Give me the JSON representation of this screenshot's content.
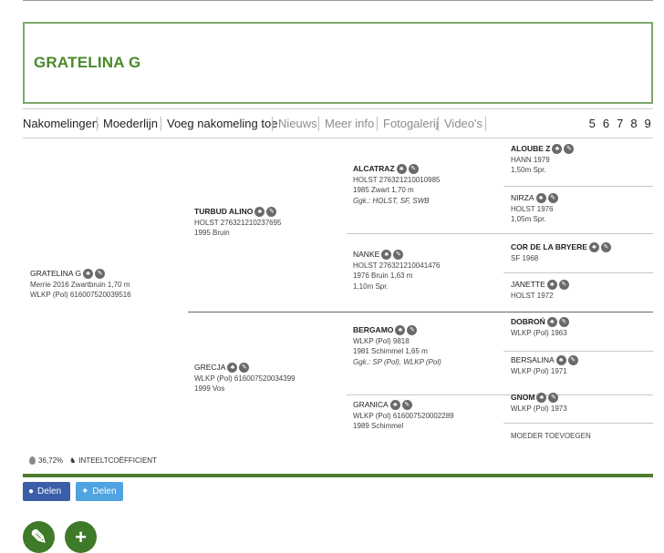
{
  "title": "GRATELINA G",
  "tabs": [
    {
      "label": "Nakomelingen"
    },
    {
      "label": "Moederlijn"
    },
    {
      "label": "Voeg nakomeling toe"
    },
    {
      "label": "Nieuws"
    },
    {
      "label": "Meer info"
    },
    {
      "label": "Fotogalerij"
    },
    {
      "label": "Video's"
    }
  ],
  "pages": "5 6 7 8 9",
  "subject": {
    "name": "GRATELINA G",
    "line1": "Merrie 2016 Zwartbruin 1,70 m",
    "line2": "WLKP (Pol) 616007520039516"
  },
  "sire": {
    "name": "TURBUD ALINO",
    "line1": "HOLST 276321210237695",
    "line2": "1995 Bruin"
  },
  "dam": {
    "name": "GRECJA",
    "line1": "WLKP (Pol) 616007520034399",
    "line2": "1999 Vos"
  },
  "ss": {
    "name": "ALCATRAZ",
    "line1": "HOLST 276321210010985",
    "line2": "1985 Zwart 1,70 m",
    "line3": "Ggk.: HOLST, SF, SWB"
  },
  "sd": {
    "name": "NANKE",
    "line1": "HOLST 276321210041476",
    "line2": "1976 Bruin 1,63 m",
    "line3": "1,10m Spr."
  },
  "ds": {
    "name": "BERGAMO",
    "line1": "WLKP (Pol) 9818",
    "line2": "1981 Schimmel 1,65 m",
    "line3": "Ggk.: SP (Pol), WLKP (Pol)"
  },
  "dd": {
    "name": "GRANICA",
    "line1": "WLKP (Pol) 616007520002289",
    "line2": "1989 Schimmel"
  },
  "g4": [
    {
      "name": "ALOUBE Z",
      "line1": "HANN 1979",
      "line2": "1,50m Spr."
    },
    {
      "name": "NIRZA",
      "line1": "HOLST 1976",
      "line2": "1,05m Spr."
    },
    {
      "name": "COR DE LA BRYERE",
      "line1": "SF 1968"
    },
    {
      "name": "JANETTE",
      "line1": "HOLST 1972"
    },
    {
      "name": "DOBROŃ",
      "line1": "WLKP (Pol) 1963"
    },
    {
      "name": "BERSALINA",
      "line1": "WLKP (Pol) 1971"
    },
    {
      "name": "GNOM",
      "line1": "WLKP (Pol) 1973"
    },
    {
      "name": "MOEDER TOEVOEGEN"
    }
  ],
  "coefficient": {
    "value": "36,72%",
    "label": "INTEELTCOËFFICIENT"
  },
  "share": {
    "facebook": "Delen",
    "twitter": "Delen"
  },
  "fab": {
    "edit": "edit-icon",
    "add": "plus-icon"
  },
  "colors": {
    "green": "#4a8a2a",
    "bar": "#4f7c2f",
    "facebook": "#3b5ea8",
    "twitter": "#4fa3e0"
  }
}
